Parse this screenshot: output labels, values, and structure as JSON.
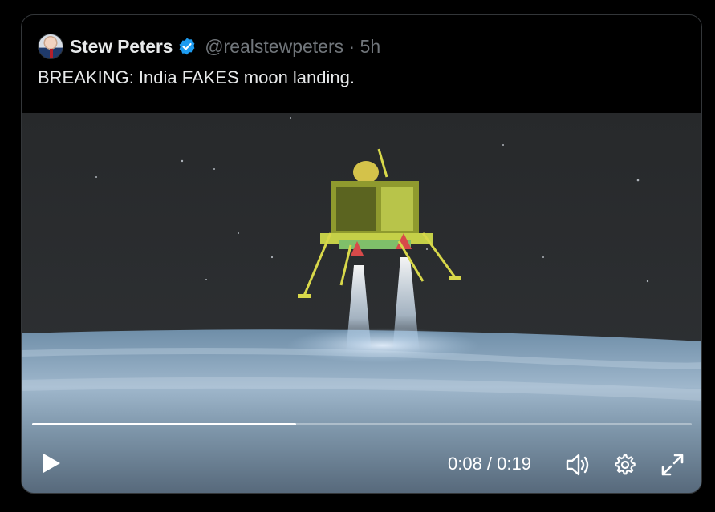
{
  "tweet": {
    "author_name": "Stew Peters",
    "handle_time": "@realstewpeters · 5h",
    "text": "BREAKING: India FAKES moon landing."
  },
  "video": {
    "current_time": "0:08",
    "duration": "0:19",
    "time_display": "0:08 / 0:19",
    "progress_fraction": 0.4,
    "icons": {
      "play": "play-icon",
      "volume": "volume-icon",
      "settings": "settings-gear-icon",
      "fullscreen": "fullscreen-icon"
    }
  },
  "colors": {
    "background": "#000000",
    "border": "#333639",
    "text_primary": "#e7e9ea",
    "text_secondary": "#71767b",
    "verified_blue": "#1d9bf0"
  }
}
